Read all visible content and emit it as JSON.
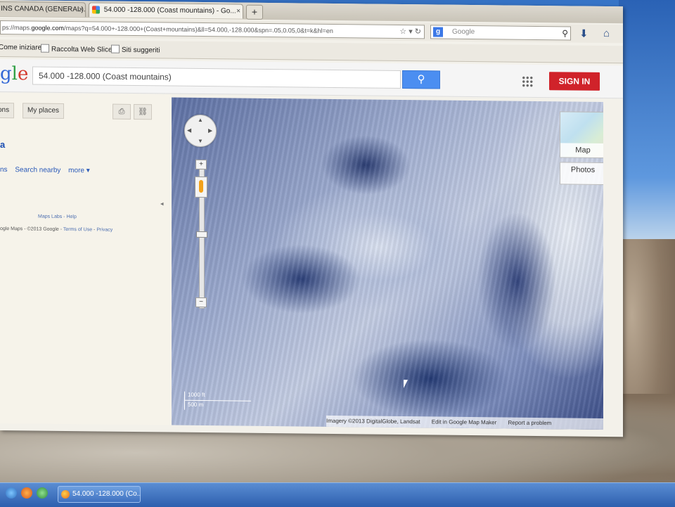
{
  "browser": {
    "tabs": [
      {
        "label": "INS CANADA (GENERAL)...",
        "active": false
      },
      {
        "label": "54.000 -128.000 (Coast mountains) - Go...",
        "active": true
      }
    ],
    "new_tab_label": "+",
    "url": {
      "prefix": "ps://maps.",
      "host": "google.com",
      "rest": "/maps?q=54.000+-128.000+(Coast+mountains)&ll=54.000,-128.000&spn=.05,0.05,0&t=k&hl=en"
    },
    "search_placeholder": "Google",
    "search_engine_badge": "g",
    "bookmarks": [
      "Come iniziare",
      "Raccolta Web Slice",
      "Siti suggeriti"
    ]
  },
  "maps": {
    "logo_partial": [
      "g",
      "l",
      "e"
    ],
    "search_value": "54.000 -128.000 (Coast mountains)",
    "sign_in_label": "SIGN IN",
    "left_panel": {
      "buttons": [
        "ons",
        "My places"
      ],
      "title": "a",
      "links": [
        "ns",
        "Search nearby",
        "more ▾"
      ],
      "labs": "Maps Labs - Help",
      "copyright_prefix": "ogle Maps - ©2013 Google -",
      "copyright_links": [
        "Terms of Use",
        "Privacy"
      ]
    },
    "map": {
      "type_button": "Map",
      "photos_button": "Photos",
      "scale": {
        "top": "1000 ft",
        "bottom": "500 m"
      },
      "attribution": [
        "Imagery ©2013 DigitalGlobe, Landsat",
        "Edit in Google Map Maker",
        "Report a problem"
      ]
    }
  },
  "taskbar": {
    "task_label": "54.000 -128.000 (Co..."
  }
}
